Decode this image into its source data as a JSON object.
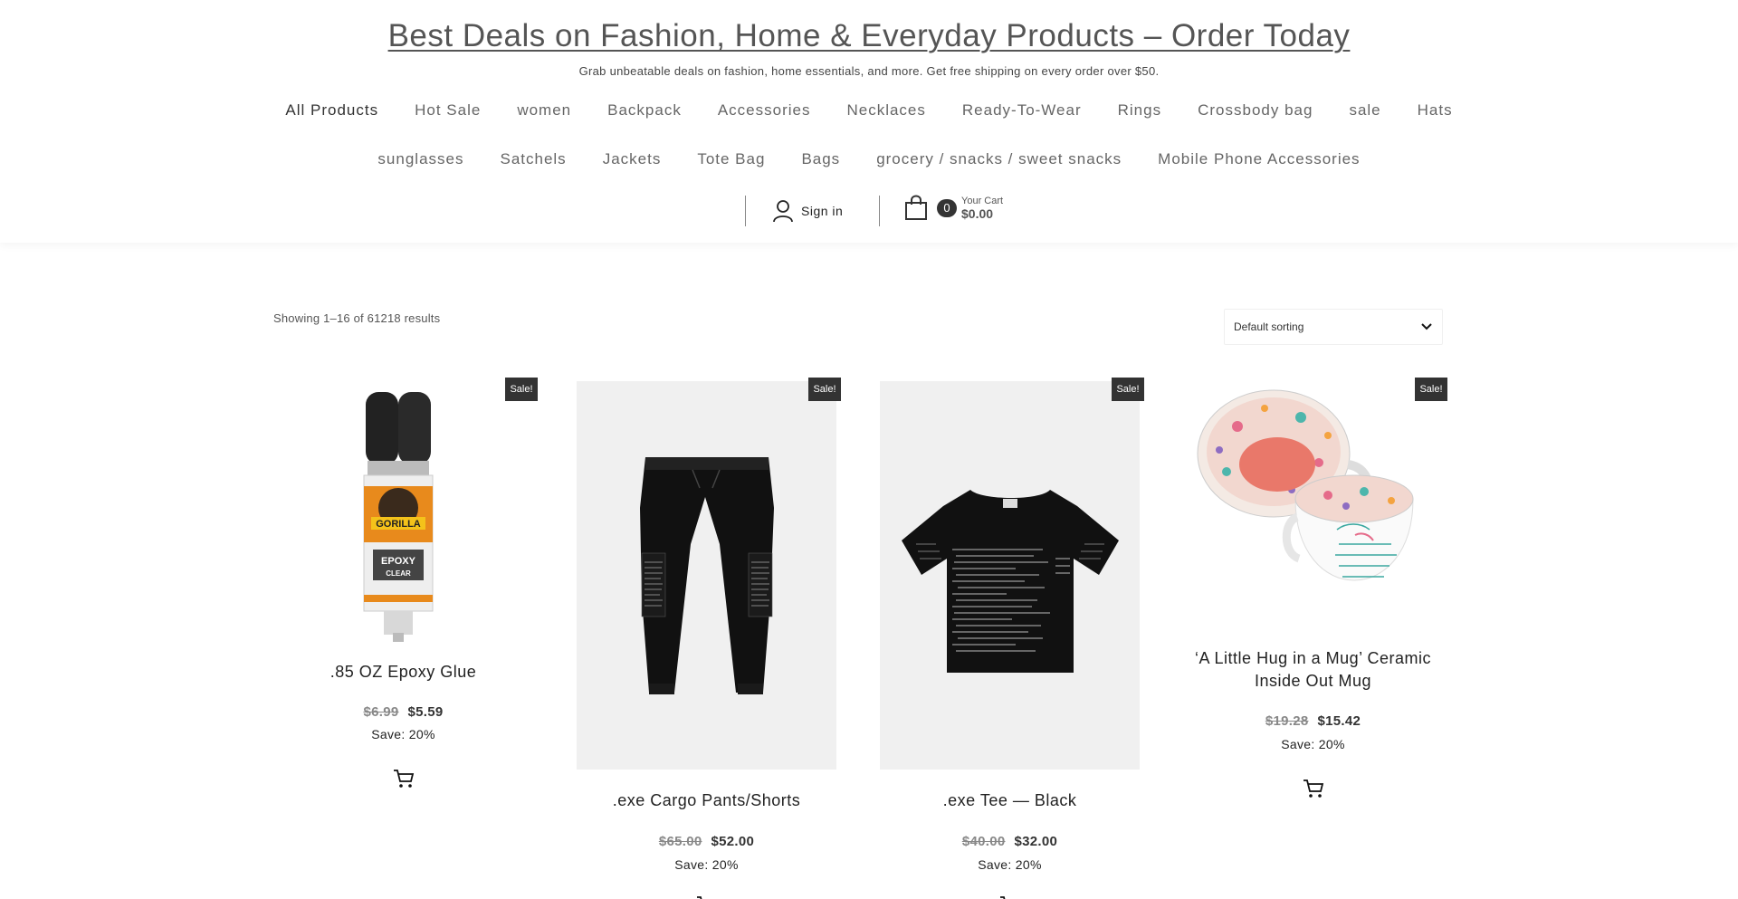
{
  "header": {
    "site_title": "Best Deals on Fashion, Home & Everyday Products – Order Today",
    "tagline": "Grab unbeatable deals on fashion, home essentials, and more. Get free shipping on every order over $50."
  },
  "nav": {
    "row1": [
      "All Products",
      "Hot Sale",
      "women",
      "Backpack",
      "Accessories",
      "Necklaces",
      "Ready-To-Wear",
      "Rings",
      "Crossbody bag",
      "sale",
      "Hats"
    ],
    "row2": [
      "sunglasses",
      "Satchels",
      "Jackets",
      "Tote Bag",
      "Bags",
      "grocery / snacks / sweet snacks",
      "Mobile Phone Accessories"
    ]
  },
  "account": {
    "sign_in_label": "Sign in",
    "cart_count": "0",
    "cart_label": "Your Cart",
    "cart_total": "$0.00"
  },
  "shop": {
    "result_count": "Showing 1–16 of 61218 results",
    "sorting_value": "Default sorting"
  },
  "products": [
    {
      "badge": "Sale!",
      "title": ".85 OZ Epoxy Glue",
      "old_price": "$6.99",
      "new_price": "$5.59",
      "save": "Save: 20%",
      "image_brand": "GORILLA",
      "image_label": "EPOXY",
      "image_sublabel": "CLEAR"
    },
    {
      "badge": "Sale!",
      "title": ".exe Cargo Pants/Shorts",
      "old_price": "$65.00",
      "new_price": "$52.00",
      "save": "Save: 20%"
    },
    {
      "badge": "Sale!",
      "title": ".exe Tee — Black",
      "old_price": "$40.00",
      "new_price": "$32.00",
      "save": "Save: 20%"
    },
    {
      "badge": "Sale!",
      "title": "‘A Little Hug in a Mug’ Ceramic Inside Out Mug",
      "old_price": "$19.28",
      "new_price": "$15.42",
      "save": "Save: 20%"
    }
  ],
  "colors": {
    "badge_bg": "#333333",
    "image_bg": "#f0f0f0",
    "old_price": "#888888"
  },
  "icons": [
    "user-icon",
    "shopping-bag-icon",
    "chevron-down-icon",
    "add-to-cart-icon"
  ]
}
